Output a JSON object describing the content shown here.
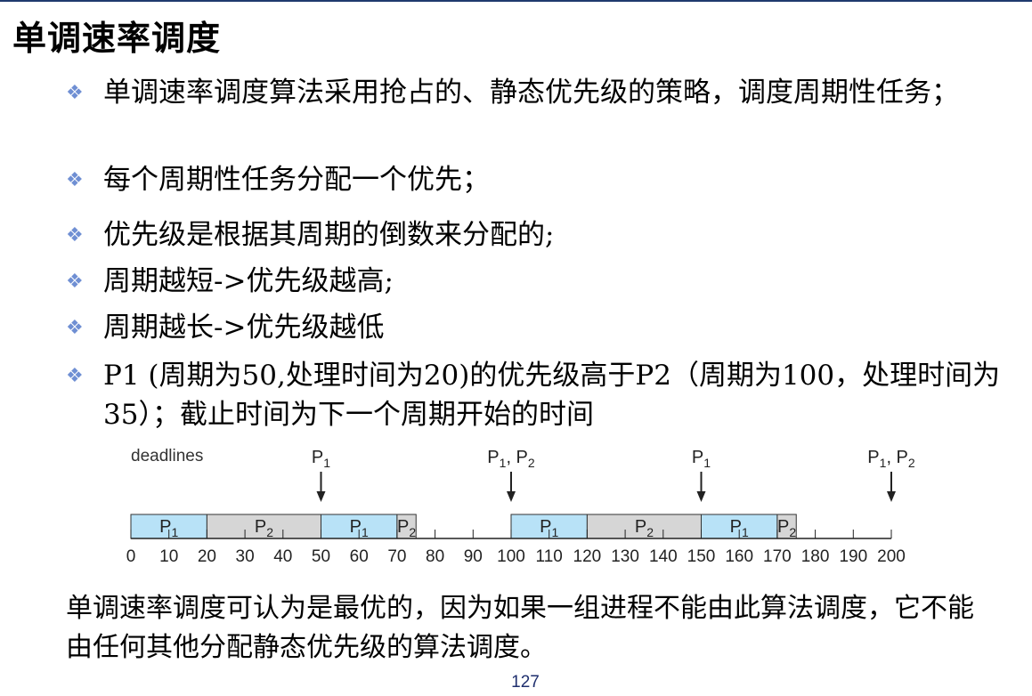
{
  "slide": {
    "title": "单调速率调度",
    "bullets": [
      "单调速率调度算法采用抢占的、静态优先级的策略，调度周期性任务；",
      "每个周期性任务分配一个优先；",
      "优先级是根据其周期的倒数来分配的;",
      "周期越短->优先级越高;",
      "周期越长->优先级越低",
      "P1 (周期为50,处理时间为20)的优先级高于P2（周期为100，处理时间为35）；截止时间为下一个周期开始的时间"
    ],
    "note": "单调速率调度可认为是最优的，因为如果一组进程不能由此算法调度，它不能由任何其他分配静态优先级的算法调度。",
    "page_number": "127"
  },
  "timeline": {
    "deadlines_label": "deadlines",
    "axis_min": 0,
    "axis_max": 200,
    "tick_labels": [
      "0",
      "10",
      "20",
      "30",
      "40",
      "50",
      "60",
      "70",
      "80",
      "90",
      "100",
      "110",
      "120",
      "130",
      "140",
      "150",
      "160",
      "170",
      "180",
      "190",
      "200"
    ],
    "deadline_markers": [
      {
        "time": 50,
        "label": "P",
        "sub": "1",
        "label2": "",
        "sub2": ""
      },
      {
        "time": 100,
        "label": "P",
        "sub": "1",
        "label2": ", P",
        "sub2": "2"
      },
      {
        "time": 150,
        "label": "P",
        "sub": "1",
        "label2": "",
        "sub2": ""
      },
      {
        "time": 200,
        "label": "P",
        "sub": "1",
        "label2": ", P",
        "sub2": "2"
      }
    ],
    "segments": [
      {
        "start": 0,
        "end": 20,
        "label": "P",
        "sub": "1",
        "color": "#b8e2f7"
      },
      {
        "start": 20,
        "end": 50,
        "label": "P",
        "sub": "2",
        "color": "#d6d6d6"
      },
      {
        "start": 50,
        "end": 70,
        "label": "P",
        "sub": "1",
        "color": "#b8e2f7"
      },
      {
        "start": 70,
        "end": 75,
        "label": "P",
        "sub": "2",
        "color": "#d6d6d6"
      },
      {
        "start": 100,
        "end": 120,
        "label": "P",
        "sub": "1",
        "color": "#b8e2f7"
      },
      {
        "start": 120,
        "end": 150,
        "label": "P",
        "sub": "2",
        "color": "#d6d6d6"
      },
      {
        "start": 150,
        "end": 170,
        "label": "P",
        "sub": "1",
        "color": "#b8e2f7"
      },
      {
        "start": 170,
        "end": 175,
        "label": "P",
        "sub": "2",
        "color": "#d6d6d6"
      }
    ]
  },
  "colors": {
    "bullet_mark": "#6f8fd3",
    "p1_fill": "#b8e2f7",
    "p2_fill": "#d6d6d6",
    "top_line": "#1f3a6e"
  }
}
